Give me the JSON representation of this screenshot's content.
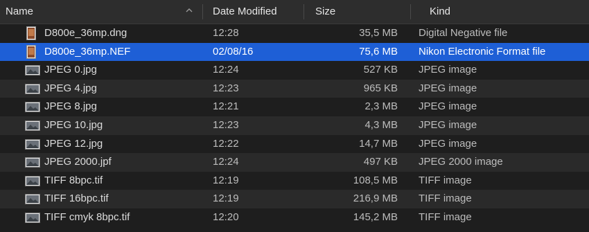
{
  "columns": {
    "name": "Name",
    "date": "Date Modified",
    "size": "Size",
    "kind": "Kind"
  },
  "files": [
    {
      "name": "D800e_36mp.dng",
      "date": "12:28",
      "size": "35,5 MB",
      "kind": "Digital Negative file",
      "icon": "raw-photo-icon"
    },
    {
      "name": "D800e_36mp.NEF",
      "date": "02/08/16",
      "size": "75,6 MB",
      "kind": "Nikon Electronic Format file",
      "icon": "raw-photo-icon",
      "selected": true
    },
    {
      "name": "JPEG 0.jpg",
      "date": "12:24",
      "size": "527 KB",
      "kind": "JPEG image",
      "icon": "image-file-icon"
    },
    {
      "name": "JPEG 4.jpg",
      "date": "12:23",
      "size": "965 KB",
      "kind": "JPEG image",
      "icon": "image-file-icon"
    },
    {
      "name": "JPEG 8.jpg",
      "date": "12:21",
      "size": "2,3 MB",
      "kind": "JPEG image",
      "icon": "image-file-icon"
    },
    {
      "name": "JPEG 10.jpg",
      "date": "12:23",
      "size": "4,3 MB",
      "kind": "JPEG image",
      "icon": "image-file-icon"
    },
    {
      "name": "JPEG 12.jpg",
      "date": "12:22",
      "size": "14,7 MB",
      "kind": "JPEG image",
      "icon": "image-file-icon"
    },
    {
      "name": "JPEG 2000.jpf",
      "date": "12:24",
      "size": "497 KB",
      "kind": "JPEG 2000 image",
      "icon": "image-file-icon"
    },
    {
      "name": "TIFF 8bpc.tif",
      "date": "12:19",
      "size": "108,5 MB",
      "kind": "TIFF image",
      "icon": "image-file-icon"
    },
    {
      "name": "TIFF 16bpc.tif",
      "date": "12:19",
      "size": "216,9 MB",
      "kind": "TIFF image",
      "icon": "image-file-icon"
    },
    {
      "name": "TIFF cmyk 8bpc.tif",
      "date": "12:20",
      "size": "145,2 MB",
      "kind": "TIFF image",
      "icon": "image-file-icon"
    }
  ],
  "colors": {
    "selection": "#1e5fd6",
    "background": "#1e1e1e",
    "row_alt": "#2a2a2a",
    "header": "#2d2d2d"
  }
}
